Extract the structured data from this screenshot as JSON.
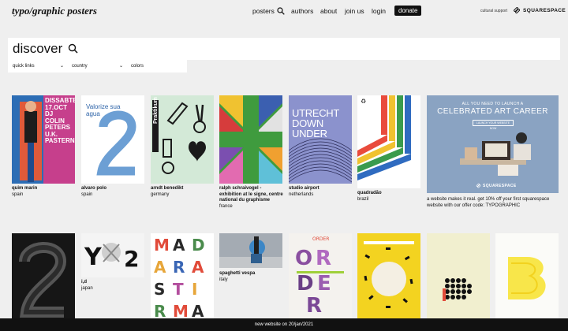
{
  "header": {
    "logo": "typo/graphic posters",
    "nav": {
      "posters": "posters",
      "authors": "authors",
      "about": "about",
      "join": "join us",
      "login": "login"
    },
    "donate": "donate",
    "cultural_support": "cultural support",
    "sponsor": "SQUARESPACE"
  },
  "search": {
    "title": "discover",
    "icon": "search-icon"
  },
  "filters": {
    "quick_links": "quick links",
    "country": "country",
    "colors": "colors"
  },
  "posters_row1": [
    {
      "author": "quim marin",
      "country": "spain",
      "text": "DISSABTE 17.OCT DJ COLIN PETERS U.K. PASTERNAK"
    },
    {
      "author": "alvaro polo",
      "country": "spain",
      "text": "Valorize sua agua"
    },
    {
      "author": "arndt benedikt",
      "country": "germany",
      "text": "Praktikum"
    },
    {
      "author": "ralph schraivogel - exhibition at le signe, centre national du graphisme",
      "country": "france",
      "text": ""
    },
    {
      "author": "studio airport",
      "country": "netherlands",
      "text": "UTRECHT DOWN UNDER"
    },
    {
      "author": "quadradão",
      "country": "brazil",
      "text": ""
    }
  ],
  "ad": {
    "headline": "CELEBRATED ART CAREER",
    "top_text": "ALL YOU NEED TO LAUNCH A",
    "cta": "LAUNCH YOUR WEBSITE NOW",
    "brand": "SQUARESPACE",
    "body": "a website makes it real. get 10% off your first squarespace website with our offer code: TYPOGRAPHIC"
  },
  "posters_row2": [
    {
      "author": "",
      "country": "",
      "text": ""
    },
    {
      "author": "i,d",
      "country": "japan",
      "text": ""
    },
    {
      "author": "",
      "country": "",
      "text": "MADARASTIRMA"
    },
    {
      "author": "spaghetti vespa",
      "country": "italy",
      "text": ""
    },
    {
      "author": "",
      "country": "",
      "text": "ORDER"
    },
    {
      "author": "",
      "country": "",
      "text": ""
    },
    {
      "author": "",
      "country": "",
      "text": ""
    },
    {
      "author": "",
      "country": "",
      "text": ""
    }
  ],
  "footer": {
    "text": "new website on 20/jan/2021"
  },
  "colors": {
    "background": "#efefef",
    "footer": "#111111",
    "ad_bg": "#8aa3c2"
  }
}
